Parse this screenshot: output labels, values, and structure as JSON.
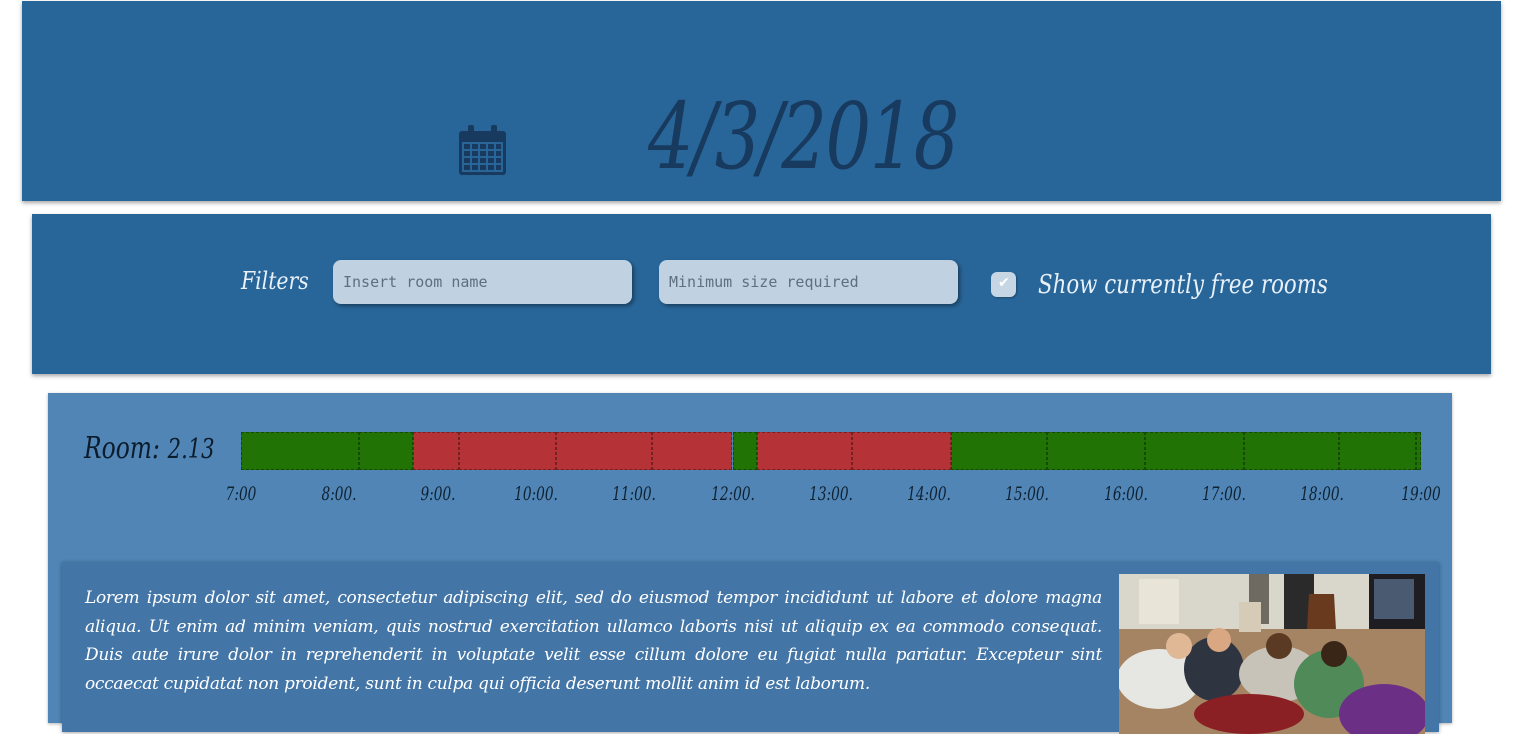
{
  "header": {
    "date": "4/3/2018",
    "icon": "calendar-icon"
  },
  "filters": {
    "label": "Filters",
    "room_name_placeholder": "Insert room name",
    "min_size_placeholder": "Minimum size required",
    "show_free_checked": true,
    "show_free_label": "Show currently free rooms"
  },
  "room": {
    "label": "Room:",
    "number": "2.13",
    "time_labels": [
      "7:00",
      "8:00.",
      "9:00.",
      "10:00.",
      "11:00.",
      "12:00.",
      "13:00.",
      "14:00.",
      "15:00.",
      "16:00.",
      "17:00.",
      "18:00.",
      "19:00"
    ],
    "schedule": [
      {
        "status": "free",
        "start": 7.0,
        "end": 8.2
      },
      {
        "status": "free",
        "start": 8.2,
        "end": 8.75
      },
      {
        "status": "busy",
        "start": 8.75,
        "end": 9.22
      },
      {
        "status": "busy",
        "start": 9.22,
        "end": 10.2
      },
      {
        "status": "busy",
        "start": 10.2,
        "end": 11.18
      },
      {
        "status": "busy",
        "start": 11.18,
        "end": 12.0
      },
      {
        "status": "free",
        "start": 12.0,
        "end": 12.25
      },
      {
        "status": "busy",
        "start": 12.25,
        "end": 13.22
      },
      {
        "status": "busy",
        "start": 13.22,
        "end": 14.22
      },
      {
        "status": "free",
        "start": 14.22,
        "end": 15.2
      },
      {
        "status": "free",
        "start": 15.2,
        "end": 16.2
      },
      {
        "status": "free",
        "start": 16.2,
        "end": 17.2
      },
      {
        "status": "free",
        "start": 17.2,
        "end": 18.17
      },
      {
        "status": "free",
        "start": 18.17,
        "end": 18.95
      },
      {
        "status": "free",
        "start": 18.95,
        "end": 19.0
      }
    ],
    "colors": {
      "free": "#227306",
      "busy": "#b53236"
    },
    "description": "Lorem ipsum dolor sit amet, consectetur adipiscing elit, sed do eiusmod tempor incididunt ut labore et dolore magna aliqua. Ut enim ad minim veniam, quis nostrud exercitation ullamco laboris nisi ut aliquip ex ea commodo consequat. Duis aute irure dolor in reprehenderit in voluptate velit esse cillum dolore eu fugiat nulla pariatur. Excepteur sint occaecat cupidatat non proident, sunt in culpa qui officia deserunt mollit anim id est laborum."
  }
}
